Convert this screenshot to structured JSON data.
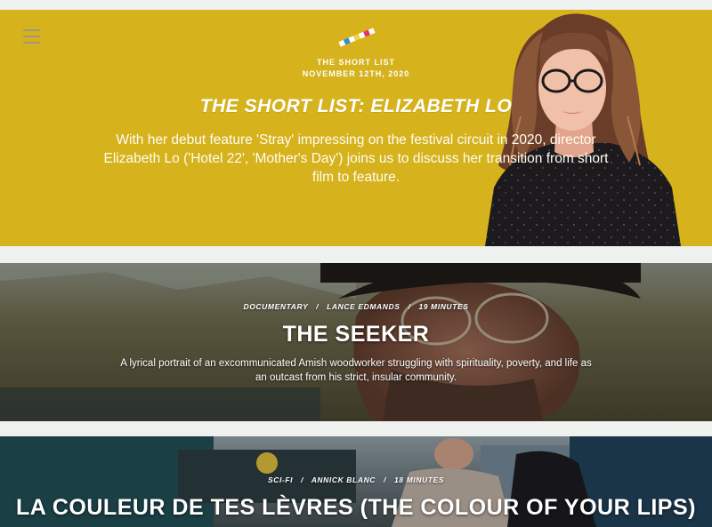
{
  "hero": {
    "category": "THE SHORT LIST",
    "date": "NOVEMBER 12TH, 2020",
    "title": "The Short List: Elizabeth Lo",
    "description": "With her debut feature 'Stray' impressing on the festival circuit in 2020, director Elizabeth Lo ('Hotel 22', 'Mother's Day') joins us to discuss her transition from short film to feature.",
    "background_color": "#d6b21d"
  },
  "films": [
    {
      "genre": "DOCUMENTARY",
      "director": "LANCE EDMANDS",
      "runtime": "19 MINUTES",
      "title": "THE SEEKER",
      "description": "A lyrical portrait of an excommunicated Amish woodworker struggling with spirituality, poverty, and life as an outcast from his strict, insular community."
    },
    {
      "genre": "SCI-FI",
      "director": "ANNICK BLANC",
      "runtime": "18 MINUTES",
      "title": "LA COULEUR DE TES LÈVRES (THE COLOUR OF YOUR LIPS)"
    }
  ],
  "separator": "/",
  "icons": {
    "menu": "hamburger-menu-icon",
    "logo": "striped-pencil-logo"
  }
}
